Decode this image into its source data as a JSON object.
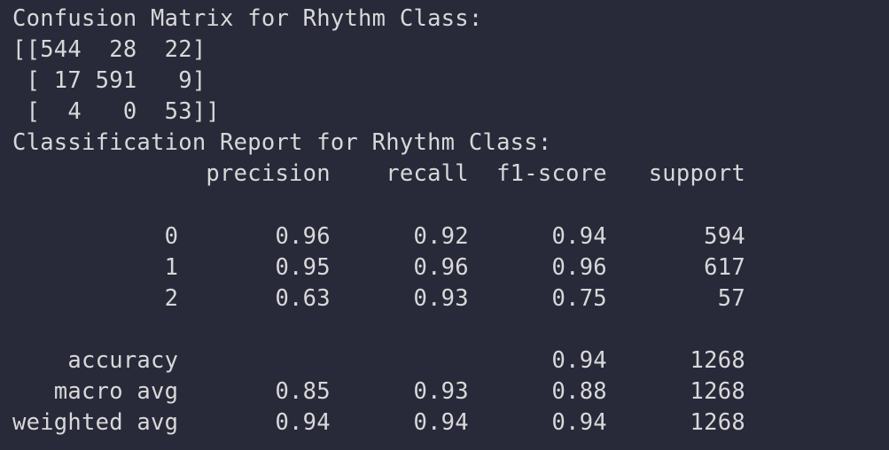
{
  "terminal": {
    "lines": [
      "Confusion Matrix for Rhythm Class:",
      "[[544  28  22]",
      " [ 17 591   9]",
      " [  4   0  53]]",
      "Classification Report for Rhythm Class:",
      "              precision    recall  f1-score   support",
      "",
      "           0       0.96      0.92      0.94       594",
      "           1       0.95      0.96      0.96       617",
      "           2       0.63      0.93      0.75        57",
      "",
      "    accuracy                           0.94      1268",
      "   macro avg       0.85      0.93      0.88      1268",
      "weighted avg       0.94      0.94      0.94      1268"
    ]
  },
  "colors": {
    "background": "#282a3a",
    "text": "#d8d8d8"
  }
}
